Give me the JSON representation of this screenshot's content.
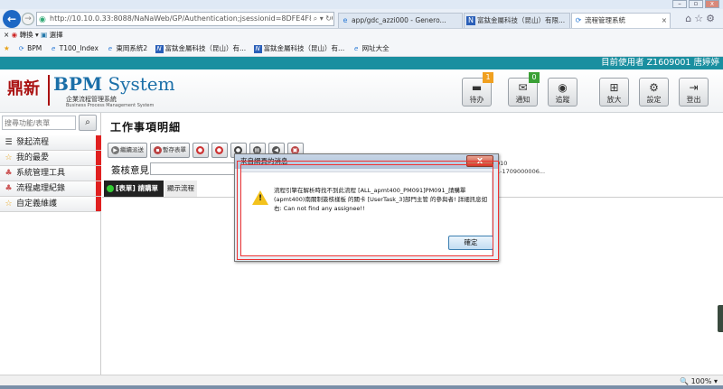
{
  "browser": {
    "address": "http://10.10.0.33:8088/NaNaWeb/GP/Authentication;jsessionid=8DFE4F85ED92BEAB6408FD",
    "tabs": [
      {
        "label": "app/gdc_azzi000 - Genero..."
      },
      {
        "label": "富鈦金屬科技（昆山）有限..."
      },
      {
        "label": "流程管理系統"
      }
    ],
    "command": {
      "convert": "轉換",
      "select": "選擇"
    },
    "favorites": [
      "BPM",
      "T100_Index",
      "東岡系統2",
      "富鈦金屬科技（昆山）有...",
      "富鈦金屬科技（昆山）有...",
      "网址大全"
    ],
    "zoom": "100%"
  },
  "user_bar": "目前使用者 Z1609001 唐婷婷",
  "logo": {
    "cn": "鼎新",
    "en_bold": "BPM",
    "en_rest": " System",
    "sub_cn": "企業流程管理系統",
    "sub_en": "Business Process Management System"
  },
  "header_buttons": [
    {
      "label": "待办",
      "badge": "1",
      "badge_color": "#f0a020"
    },
    {
      "label": "通知",
      "badge": "0",
      "badge_color": "#3aa035"
    },
    {
      "label": "追蹤"
    },
    {
      "label": "放大"
    },
    {
      "label": "設定"
    },
    {
      "label": "登出"
    }
  ],
  "sidebar": {
    "search_placeholder": "搜尋功能/表單",
    "items": [
      {
        "label": "發起流程"
      },
      {
        "label": "我的最愛"
      },
      {
        "label": "系統管理工具"
      },
      {
        "label": "流程處理紀錄"
      },
      {
        "label": "自定義維護"
      }
    ]
  },
  "main": {
    "title": "工作事項明細",
    "toolbar": {
      "btn1": "繼續派送",
      "btn2": "暫存表單"
    },
    "signature_label": "簽核意見:",
    "info1": "010",
    "info2": "1-1709000006...",
    "subtab_form": "[表單] 請購單",
    "subtab_flow": "顯示流程"
  },
  "dialog": {
    "title": "來自網頁的消息",
    "message": "流程引擎在解析時找不到此流程 [ALL_apmt400_PM091]PM091_請購單(apmt400)南關制簽核樣板 的關卡 [UserTask_3]部門主管 的參與者! 詳細訊息如右: Can not find any assignee!!",
    "ok": "確定",
    "close": "X"
  }
}
